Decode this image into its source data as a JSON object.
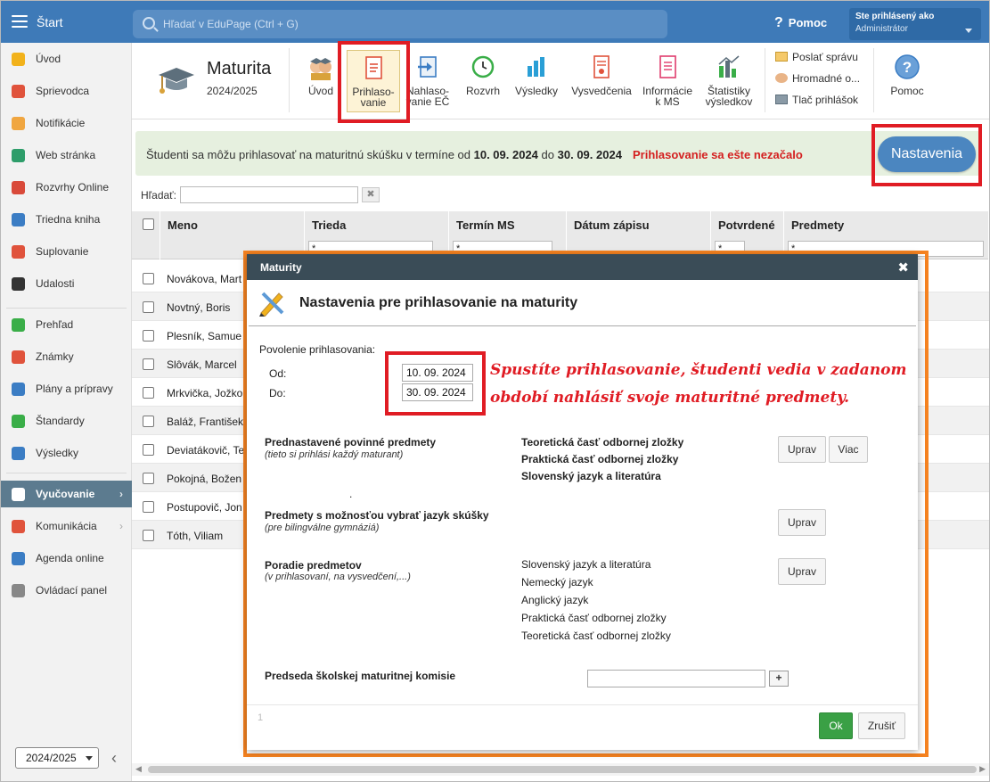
{
  "topbar": {
    "app_title": "Štart",
    "search_placeholder": "Hľadať v EduPage (Ctrl + G)",
    "help_label": "Pomoc",
    "user_line1": "Ste prihlásený ako",
    "user_line2": "Administrátor"
  },
  "sidebar": {
    "items": [
      {
        "label": "Úvod",
        "icon": "star-icon",
        "color": "#f2b21b"
      },
      {
        "label": "Sprievodca",
        "icon": "wand-icon",
        "color": "#e0533c"
      },
      {
        "label": "Notifikácie",
        "icon": "envelope-icon",
        "color": "#f0a640"
      },
      {
        "label": "Web stránka",
        "icon": "house-icon",
        "color": "#2e9d6a"
      },
      {
        "label": "Rozvrhy Online",
        "icon": "grid-icon",
        "color": "#d94a3a"
      },
      {
        "label": "Triedna kniha",
        "icon": "book-icon",
        "color": "#3b7dc4"
      },
      {
        "label": "Suplovanie",
        "icon": "person-icon",
        "color": "#e0533c"
      },
      {
        "label": "Udalosti",
        "icon": "calendar-icon",
        "color": "#333333"
      },
      {
        "label": "Prehľad",
        "icon": "check-circle-icon",
        "color": "#3aae48"
      },
      {
        "label": "Známky",
        "icon": "grade-icon",
        "color": "#e0533c"
      },
      {
        "label": "Plány a prípravy",
        "icon": "briefcase-icon",
        "color": "#3b7dc4"
      },
      {
        "label": "Štandardy",
        "icon": "shield-check-icon",
        "color": "#3aae48"
      },
      {
        "label": "Výsledky",
        "icon": "bar-chart-icon",
        "color": "#3b7dc4"
      },
      {
        "label": "Vyučovanie",
        "icon": "open-book-icon",
        "color": "#ffffff",
        "active": true
      },
      {
        "label": "Komunikácia",
        "icon": "chat-icon",
        "color": "#e0533c"
      },
      {
        "label": "Agenda online",
        "icon": "pen-icon",
        "color": "#3b7dc4"
      },
      {
        "label": "Ovládací panel",
        "icon": "gear-icon",
        "color": "#888888"
      }
    ],
    "year_selected": "2024/2025"
  },
  "toolbar": {
    "title": "Maturita",
    "year": "2024/2025",
    "buttons": [
      {
        "line1": "Úvod",
        "line2": ""
      },
      {
        "line1": "Prihlaso-",
        "line2": "vanie"
      },
      {
        "line1": "Nahlaso-",
        "line2": "vanie EČ"
      },
      {
        "line1": "Rozvrh",
        "line2": ""
      },
      {
        "line1": "Výsledky",
        "line2": ""
      },
      {
        "line1": "Vysvedčenia",
        "line2": ""
      },
      {
        "line1": "Informácie",
        "line2": "k MS"
      },
      {
        "line1": "Štatistiky",
        "line2": "výsledkov"
      }
    ],
    "small_actions": [
      "Poslať správu",
      "Hromadné o...",
      "Tlač prihlášok"
    ],
    "help_label": "Pomoc"
  },
  "notice": {
    "prefix": "Študenti sa môžu prihlasovať na maturitnú skúšku v termíne od",
    "from": "10. 09. 2024",
    "mid": "do",
    "to": "30. 09. 2024",
    "warning": "Prihlasovanie sa ešte nezačalo",
    "settings_button": "Nastavenia"
  },
  "filter": {
    "label": "Hľadať:",
    "value": "",
    "clear": "✖"
  },
  "table": {
    "headers": [
      "Meno",
      "Trieda",
      "Termín MS",
      "Dátum zápisu",
      "Potvrdené",
      "Predmety"
    ],
    "filter_values": [
      "*",
      "*",
      "*",
      "*"
    ],
    "rows": [
      "Novákova, Mart",
      "Novtný, Boris",
      "Plesník, Samue",
      "Slôvák, Marcel",
      "Mrkvička, Jožko",
      "Baláž, František",
      "Deviatákovič, Te",
      "Pokojná, Božen",
      "Postupovič, Jon",
      "Tóth, Viliam"
    ]
  },
  "dialog": {
    "header": "Maturity",
    "close": "✖",
    "title": "Nastavenia pre prihlasovanie na maturity",
    "permission_label": "Povolenie prihlasovania:",
    "from_label": "Od:",
    "from_value": "10. 09. 2024",
    "to_label": "Do:",
    "to_value": "30. 09. 2024",
    "preset": {
      "label": "Prednastavené povinné predmety",
      "hint": "(tieto si prihlási každý maturant)",
      "subjects": [
        "Teoretická časť odbornej zložky",
        "Praktická časť odbornej zložky",
        "Slovenský jazyk a literatúra"
      ],
      "edit": "Uprav",
      "more": "Viac"
    },
    "dot": ".",
    "language": {
      "label": "Predmety s možnosťou vybrať jazyk skúšky",
      "hint": "(pre bilingválne gymnáziá)",
      "edit": "Uprav"
    },
    "order": {
      "label": "Poradie predmetov",
      "hint": "(v prihlasovaní, na vysvedčení,...)",
      "subjects": [
        "Slovenský jazyk a literatúra",
        "Nemecký jazyk",
        "Anglický jazyk",
        "Praktická časť odbornej zložky",
        "Teoretická časť odbornej zložky"
      ],
      "edit": "Uprav"
    },
    "chair": {
      "label": "Predseda školskej maturitnej komisie",
      "value": "",
      "plus": "+"
    },
    "page": "1",
    "ok": "Ok",
    "cancel": "Zrušiť"
  },
  "annotation": {
    "line1": "Spustíte prihlasovanie, študenti vedia v zadanom",
    "line2": "období nahlásiť svoje maturitné predmety."
  },
  "colors": {
    "topbar": "#3e7ab8",
    "highlight_red": "#e01c24",
    "highlight_orange": "#f58220",
    "ok_green": "#3aa045",
    "settings_blue": "#4b86c0"
  }
}
